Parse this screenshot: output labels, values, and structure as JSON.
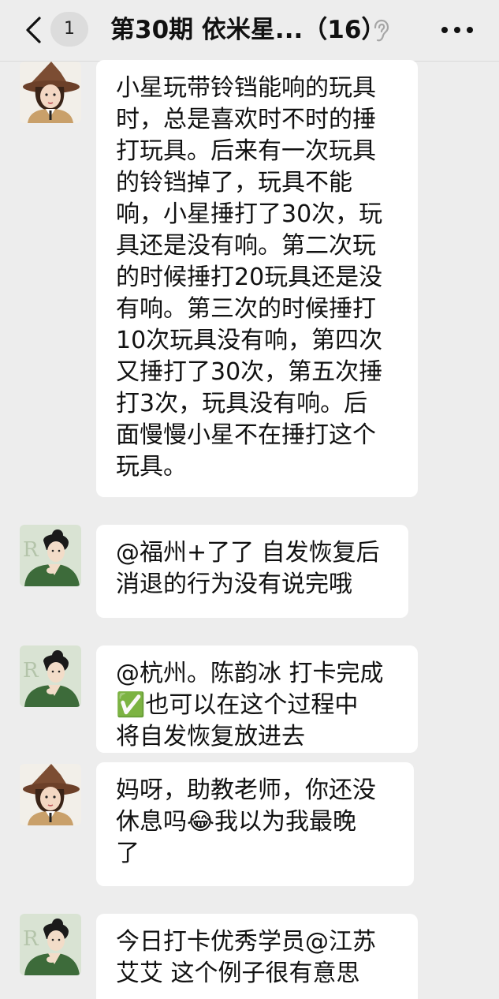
{
  "header": {
    "back_icon": "chevron-left-icon",
    "unread_count": "1",
    "title": "第30期 依米星...（16）",
    "mute_icon": "ear-mute-icon",
    "more_icon": "more-dots-icon"
  },
  "messages": [
    {
      "avatar": "witch-hat-girl-avatar",
      "text": "小星玩带铃铛能响的玩具\n时，总是喜欢时不时的捶\n打玩具。后来有一次玩具\n的铃铛掉了，玩具不能\n响，小星捶打了30次，玩\n具还是没有响。第二次玩\n的时候捶打20玩具还是没\n有响。第三次的时候捶打\n10次玩具没有响，第四次\n又捶打了30次，第五次捶\n打3次，玩具没有响。后\n面慢慢小星不在捶打这个\n玩具。"
    },
    {
      "avatar": "scholar-portrait-avatar",
      "text": "@福州+了了 自发恢复后\n消退的行为没有说完哦"
    },
    {
      "avatar": "scholar-portrait-avatar",
      "text": "@杭州。陈韵冰 打卡完成\n✅也可以在这个过程中\n将自发恢复放进去"
    },
    {
      "avatar": "witch-hat-girl-avatar",
      "text": "妈呀，助教老师，你还没\n休息吗😂我以为我最晚\n了"
    },
    {
      "avatar": "scholar-portrait-avatar",
      "text": "今日打卡优秀学员@江苏\n艾艾 这个例子很有意思"
    }
  ]
}
